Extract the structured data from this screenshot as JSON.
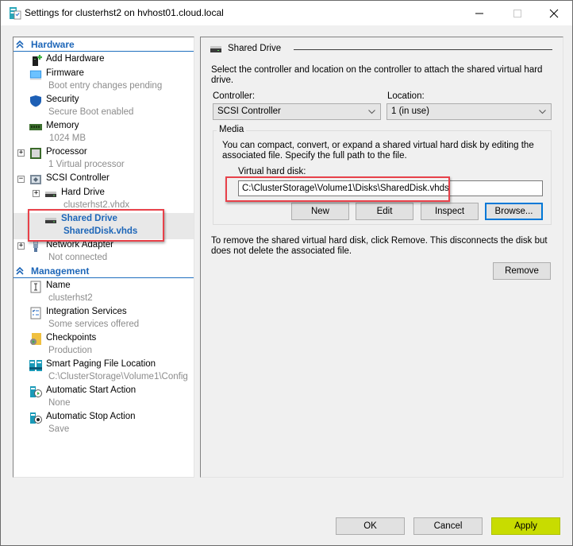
{
  "window": {
    "title": "Settings for clusterhst2 on hvhost01.cloud.local",
    "controls": {
      "minimize": "minimize",
      "maximize": "maximize",
      "close": "close"
    }
  },
  "tree": {
    "hardware_header": "Hardware",
    "management_header": "Management",
    "hardware_items": [
      {
        "name": "Add Hardware",
        "sub": "",
        "icon": "add-hardware-icon"
      },
      {
        "name": "Firmware",
        "sub": "Boot entry changes pending",
        "icon": "firmware-icon"
      },
      {
        "name": "Security",
        "sub": "Secure Boot enabled",
        "icon": "security-shield-icon"
      },
      {
        "name": "Memory",
        "sub": "1024 MB",
        "icon": "memory-icon"
      },
      {
        "name": "Processor",
        "sub": "1 Virtual processor",
        "icon": "processor-icon",
        "expander": "+"
      },
      {
        "name": "SCSI Controller",
        "sub": "",
        "icon": "scsi-controller-icon",
        "expander": "−"
      },
      {
        "name": "Hard Drive",
        "sub": "clusterhst2.vhdx",
        "icon": "hard-drive-icon",
        "expander": "+"
      },
      {
        "name": "Shared Drive",
        "sub": "SharedDisk.vhds",
        "icon": "shared-drive-icon",
        "selected": true
      },
      {
        "name": "Network Adapter",
        "sub": "Not connected",
        "icon": "network-adapter-icon",
        "expander": "+"
      }
    ],
    "management_items": [
      {
        "name": "Name",
        "sub": "clusterhst2",
        "icon": "name-icon"
      },
      {
        "name": "Integration Services",
        "sub": "Some services offered",
        "icon": "integration-services-icon"
      },
      {
        "name": "Checkpoints",
        "sub": "Production",
        "icon": "checkpoints-icon"
      },
      {
        "name": "Smart Paging File Location",
        "sub": "C:\\ClusterStorage\\Volume1\\Config",
        "icon": "smart-paging-icon"
      },
      {
        "name": "Automatic Start Action",
        "sub": "None",
        "icon": "auto-start-icon"
      },
      {
        "name": "Automatic Stop Action",
        "sub": "Save",
        "icon": "auto-stop-icon"
      }
    ]
  },
  "panel": {
    "title": "Shared Drive",
    "intro": "Select the controller and location on the controller to attach the shared virtual hard drive.",
    "controller_label": "Controller:",
    "controller_value": "SCSI Controller",
    "location_label": "Location:",
    "location_value": "1 (in use)",
    "media": {
      "label": "Media",
      "description": "You can compact, convert, or expand a shared virtual hard disk by editing the associated file. Specify the full path to the file.",
      "vhd_label": "Virtual hard disk:",
      "vhd_path": "C:\\ClusterStorage\\Volume1\\Disks\\SharedDisk.vhds",
      "buttons": {
        "new": "New",
        "edit": "Edit",
        "inspect": "Inspect",
        "browse": "Browse..."
      }
    },
    "remove_text": "To remove the shared virtual hard disk, click Remove. This disconnects the disk but does not delete the associated file.",
    "remove_button": "Remove"
  },
  "footer": {
    "ok": "OK",
    "cancel": "Cancel",
    "apply": "Apply"
  },
  "colors": {
    "accent": "#1d66b8",
    "highlight": "#e8414a",
    "apply": "#c8dc00",
    "focus": "#0078d7"
  }
}
